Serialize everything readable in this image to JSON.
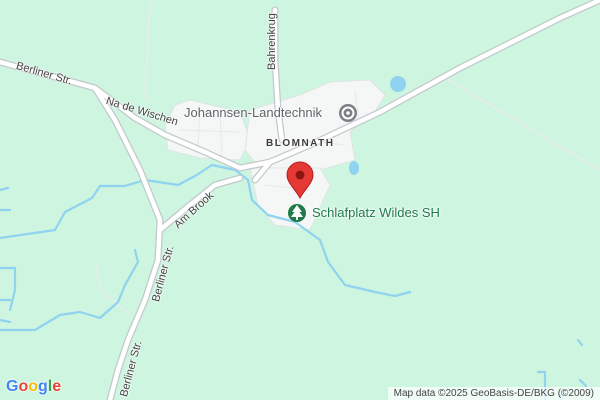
{
  "map": {
    "roads": {
      "berliner_top": "Berliner Str.",
      "berliner_mid": "Berliner Str.",
      "berliner_bottom": "Berliner Str.",
      "na_de_wischen": "Na de Wischen",
      "am_brook": "Am Brook",
      "bahrenkrug": "Bahrenkrug"
    },
    "place": {
      "name": "BLOMNATH"
    },
    "pois": {
      "shop": {
        "label": "Johannsen-Landtechnik",
        "icon": "shop-icon"
      },
      "campsite": {
        "label": "Schlafplatz Wildes SH",
        "icon": "tree-icon"
      }
    },
    "marker": {
      "icon": "map-pin-icon",
      "color": "#e53935"
    },
    "colors": {
      "land": "#cdf5df",
      "water": "#8fd3f0",
      "road": "#ffffff",
      "road_edge": "#c8ccd0",
      "park_label": "#1e7a49"
    },
    "logo": {
      "letters": [
        "G",
        "o",
        "o",
        "g",
        "l",
        "e"
      ],
      "colors": [
        "#4285f4",
        "#ea4335",
        "#fbbc05",
        "#4285f4",
        "#34a853",
        "#ea4335"
      ]
    },
    "attribution": "Map data ©2025 GeoBasis-DE/BKG (©2009)"
  }
}
